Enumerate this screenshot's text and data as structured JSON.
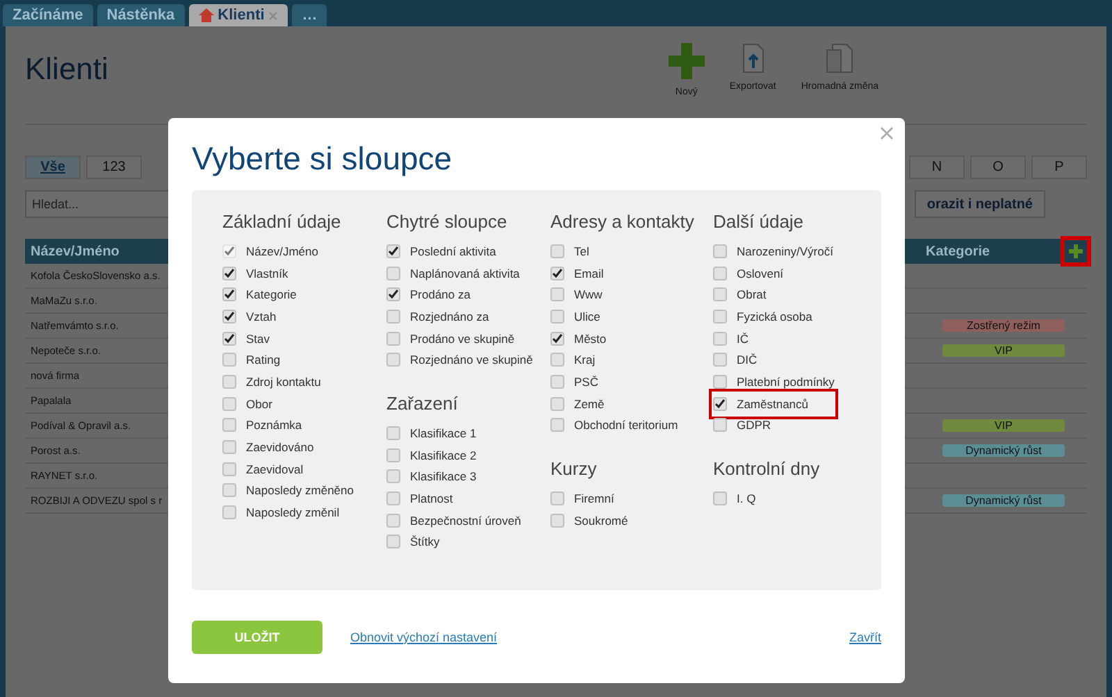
{
  "tabs": [
    {
      "label": "Začínáme",
      "selected": false,
      "closable": false
    },
    {
      "label": "Nástěnka",
      "selected": false,
      "closable": false
    },
    {
      "label": "Klienti",
      "selected": true,
      "closable": true
    },
    {
      "label": "…",
      "selected": false,
      "closable": false
    }
  ],
  "page_title": "Klienti",
  "toolbar": [
    {
      "kind": "new",
      "label": "Nový"
    },
    {
      "kind": "export",
      "label": "Exportovat"
    },
    {
      "kind": "bulk",
      "label": "Hromadná změna"
    }
  ],
  "letters_left": [
    {
      "label": "Vše",
      "selected": true
    },
    {
      "label": "123",
      "selected": false
    }
  ],
  "letters_right": [
    {
      "label": "N",
      "selected": false
    },
    {
      "label": "O",
      "selected": false
    },
    {
      "label": "P",
      "selected": false
    }
  ],
  "search": {
    "placeholder": "Hledat..."
  },
  "show_invalid_button": "orazit i neplatné",
  "table": {
    "columns": [
      "Název/Jméno",
      "Kategorie"
    ],
    "add_column_highlighted": true,
    "rows": [
      {
        "name": "Kofola ČeskoSlovensko a.s."
      },
      {
        "name": "MaMaZu s.r.o."
      },
      {
        "name": "Natřemvámto s.r.o.",
        "tag": "Zostřený režim",
        "color": "#8e5f5d"
      },
      {
        "name": "Nepoteče s.r.o.",
        "tag": "VIP",
        "color": "#6f8a3c"
      },
      {
        "name": "nová firma"
      },
      {
        "name": "Papalala"
      },
      {
        "name": "Podíval & Opravil a.s.",
        "tag": "VIP",
        "color": "#6f8a3c"
      },
      {
        "name": "Porost a.s.",
        "tag": "Dynamický růst",
        "color": "#5b8d95"
      },
      {
        "name": "RAYNET s.r.o."
      },
      {
        "name": "ROZBIJI A ODVEZU spol s r",
        "tag": "Dynamický růst",
        "color": "#5b8d95"
      }
    ]
  },
  "dialog": {
    "title": "Vyberte si sloupce",
    "columns": [
      {
        "groups": [
          {
            "title": "Základní údaje",
            "items": [
              {
                "label": "Název/Jméno",
                "checked": true,
                "disabled": true,
                "highlighted": false
              },
              {
                "label": "Vlastník",
                "checked": true,
                "disabled": false,
                "highlighted": false
              },
              {
                "label": "Kategorie",
                "checked": true,
                "disabled": false,
                "highlighted": false
              },
              {
                "label": "Vztah",
                "checked": true,
                "disabled": false,
                "highlighted": false
              },
              {
                "label": "Stav",
                "checked": true,
                "disabled": false,
                "highlighted": false
              },
              {
                "label": "Rating",
                "checked": false,
                "disabled": false,
                "highlighted": false
              },
              {
                "label": "Zdroj kontaktu",
                "checked": false,
                "disabled": false,
                "highlighted": false
              },
              {
                "label": "Obor",
                "checked": false,
                "disabled": false,
                "highlighted": false
              },
              {
                "label": "Poznámka",
                "checked": false,
                "disabled": false,
                "highlighted": false
              },
              {
                "label": "Zaevidováno",
                "checked": false,
                "disabled": false,
                "highlighted": false
              },
              {
                "label": "Zaevidoval",
                "checked": false,
                "disabled": false,
                "highlighted": false
              },
              {
                "label": "Naposledy změněno",
                "checked": false,
                "disabled": false,
                "highlighted": false
              },
              {
                "label": "Naposledy změnil",
                "checked": false,
                "disabled": false,
                "highlighted": false
              }
            ]
          }
        ]
      },
      {
        "groups": [
          {
            "title": "Chytré sloupce",
            "items": [
              {
                "label": "Poslední aktivita",
                "checked": true,
                "disabled": false,
                "highlighted": false
              },
              {
                "label": "Naplánovaná aktivita",
                "checked": false,
                "disabled": false,
                "highlighted": false
              },
              {
                "label": "Prodáno za",
                "checked": true,
                "disabled": false,
                "highlighted": false
              },
              {
                "label": "Rozjednáno za",
                "checked": false,
                "disabled": false,
                "highlighted": false
              },
              {
                "label": "Prodáno ve skupině",
                "checked": false,
                "disabled": false,
                "highlighted": false
              },
              {
                "label": "Rozjednáno ve skupině",
                "checked": false,
                "disabled": false,
                "highlighted": false
              }
            ]
          },
          {
            "title": "Zařazení",
            "items": [
              {
                "label": "Klasifikace 1",
                "checked": false,
                "disabled": false,
                "highlighted": false
              },
              {
                "label": "Klasifikace 2",
                "checked": false,
                "disabled": false,
                "highlighted": false
              },
              {
                "label": "Klasifikace 3",
                "checked": false,
                "disabled": false,
                "highlighted": false
              },
              {
                "label": "Platnost",
                "checked": false,
                "disabled": false,
                "highlighted": false
              },
              {
                "label": "Bezpečnostní úroveň",
                "checked": false,
                "disabled": false,
                "highlighted": false
              },
              {
                "label": "Štítky",
                "checked": false,
                "disabled": false,
                "highlighted": false
              }
            ]
          }
        ]
      },
      {
        "groups": [
          {
            "title": "Adresy a kontakty",
            "items": [
              {
                "label": "Tel",
                "checked": false,
                "disabled": false,
                "highlighted": false
              },
              {
                "label": "Email",
                "checked": true,
                "disabled": false,
                "highlighted": false
              },
              {
                "label": "Www",
                "checked": false,
                "disabled": false,
                "highlighted": false
              },
              {
                "label": "Ulice",
                "checked": false,
                "disabled": false,
                "highlighted": false
              },
              {
                "label": "Město",
                "checked": true,
                "disabled": false,
                "highlighted": false
              },
              {
                "label": "Kraj",
                "checked": false,
                "disabled": false,
                "highlighted": false
              },
              {
                "label": "PSČ",
                "checked": false,
                "disabled": false,
                "highlighted": false
              },
              {
                "label": "Země",
                "checked": false,
                "disabled": false,
                "highlighted": false
              },
              {
                "label": "Obchodní teritorium",
                "checked": false,
                "disabled": false,
                "highlighted": false
              }
            ]
          },
          {
            "title": "Kurzy",
            "items": [
              {
                "label": "Firemní",
                "checked": false,
                "disabled": false,
                "highlighted": false
              },
              {
                "label": "Soukromé",
                "checked": false,
                "disabled": false,
                "highlighted": false
              }
            ]
          }
        ]
      },
      {
        "groups": [
          {
            "title": "Další údaje",
            "items": [
              {
                "label": "Narozeniny/Výročí",
                "checked": false,
                "disabled": false,
                "highlighted": false
              },
              {
                "label": "Oslovení",
                "checked": false,
                "disabled": false,
                "highlighted": false
              },
              {
                "label": "Obrat",
                "checked": false,
                "disabled": false,
                "highlighted": false
              },
              {
                "label": "Fyzická osoba",
                "checked": false,
                "disabled": false,
                "highlighted": false
              },
              {
                "label": "IČ",
                "checked": false,
                "disabled": false,
                "highlighted": false
              },
              {
                "label": "DIČ",
                "checked": false,
                "disabled": false,
                "highlighted": false
              },
              {
                "label": "Platební podmínky",
                "checked": false,
                "disabled": false,
                "highlighted": false
              },
              {
                "label": "Zaměstnanců",
                "checked": true,
                "disabled": false,
                "highlighted": true
              },
              {
                "label": "GDPR",
                "checked": false,
                "disabled": false,
                "highlighted": false
              }
            ]
          },
          {
            "title": "Kontrolní dny",
            "items": [
              {
                "label": "I. Q",
                "checked": false,
                "disabled": false,
                "highlighted": false
              }
            ]
          }
        ]
      }
    ],
    "save": "ULOŽIT",
    "reset": "Obnovit výchozí nastavení",
    "close": "Zavřít"
  }
}
